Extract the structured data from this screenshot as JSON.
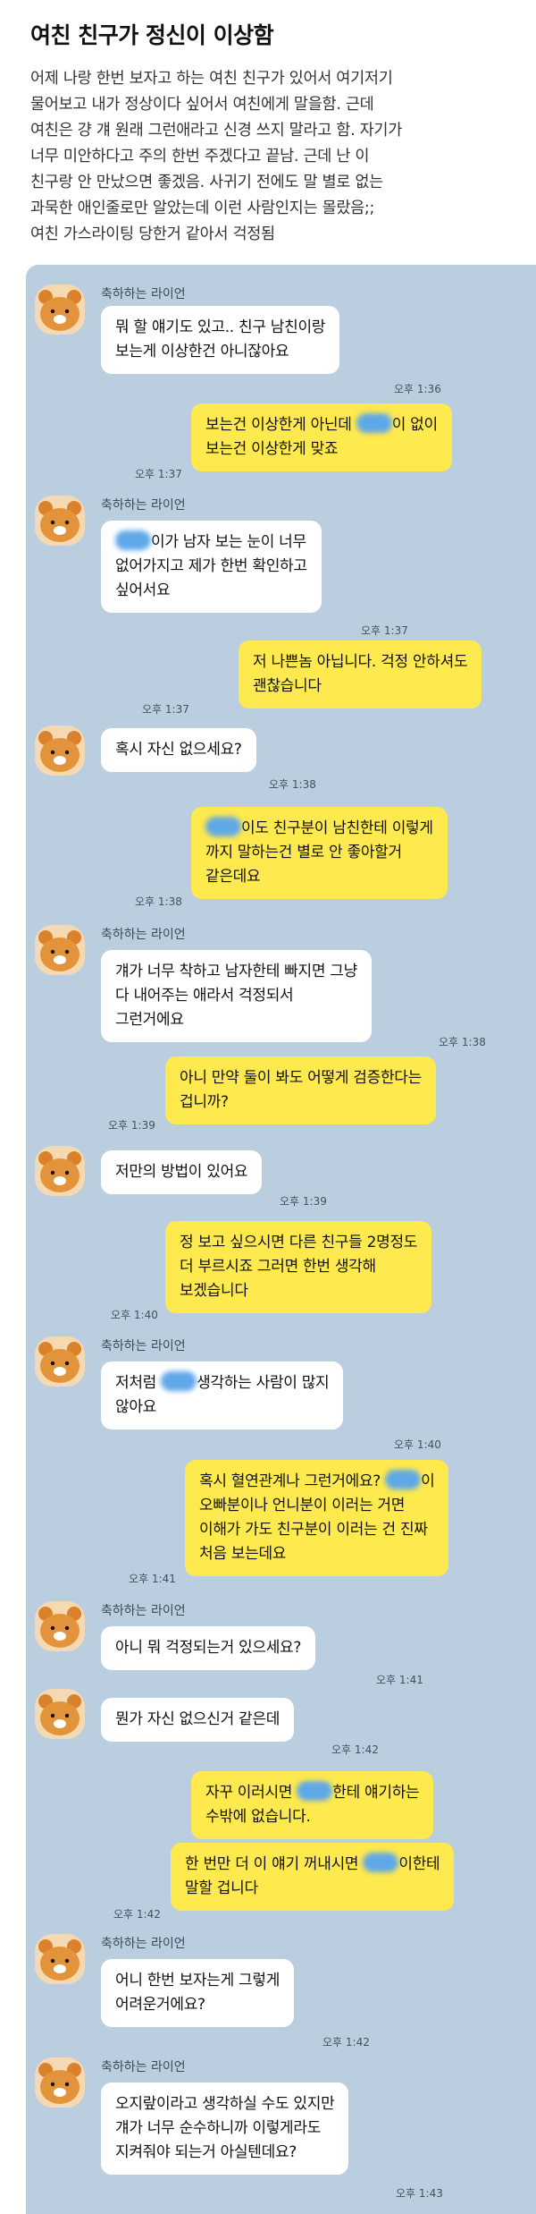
{
  "post": {
    "title": "여친 친구가 정신이 이상함",
    "body": "어제 나랑 한번 보자고 하는 여친 친구가 있어서 여기저기\n물어보고 내가 정상이다 싶어서 여친에게 말을함. 근데\n여친은 걍 걔 원래 그런애라고 신경 쓰지 말라고 함. 자기가\n너무 미안하다고 주의 한번 주겠다고 끝남. 근데 난 이\n친구랑 안 만났으면 좋겠음. 사귀기 전에도 말 별로 없는\n과묵한 애인줄로만 알았는데 이런 사람인지는 몰랐음;;\n여친 가스라이팅 당한거 같아서 걱정됨"
  },
  "sender_name": "축하하는 라이언",
  "messages": [
    {
      "text": "뭐 할 얘기도 있고.. 친구 남친이랑\n보는게 이상한건 아니잖아요",
      "time": "오후 1:36"
    },
    {
      "text_a": "보는건 이상한게 아닌데 ",
      "text_b": "이 없이\n보는건 이상한게 맞죠",
      "time": "오후 1:37"
    },
    {
      "text_a": "",
      "text_b": "이가 남자 보는 눈이 너무\n없어가지고 제가 한번 확인하고\n싶어서요",
      "time": "오후 1:37"
    },
    {
      "text": "저 나쁜놈 아닙니다. 걱정 안하셔도\n괜찮습니다",
      "time": "오후 1:37"
    },
    {
      "text": "혹시 자신 없으세요?",
      "time": "오후 1:38"
    },
    {
      "text_a": "",
      "text_b": "이도 친구분이 남친한테 이렇게\n까지 말하는건 별로 안 좋아할거\n같은데요",
      "time": "오후 1:38"
    },
    {
      "text": "걔가 너무 착하고 남자한테 빠지면 그냥\n다 내어주는 애라서 걱정되서\n그런거에요",
      "time": "오후 1:38"
    },
    {
      "text": "아니 만약 둘이 봐도 어떻게 검증한다는\n겁니까?",
      "time": "오후 1:39"
    },
    {
      "text": "저만의 방법이 있어요",
      "time": "오후 1:39"
    },
    {
      "text": "정 보고 싶으시면 다른 친구들 2명정도\n더 부르시죠 그러면 한번 생각해\n보겠습니다",
      "time": "오후 1:40"
    },
    {
      "text_a": "저처럼 ",
      "text_b": "생각하는 사람이 많지\n않아요",
      "time": "오후 1:40"
    },
    {
      "text_a": "혹시 혈연관계나 그런거에요? ",
      "text_b": "이\n오빠분이나 언니분이 이러는 거면\n이해가 가도 친구분이 이러는 건 진짜\n처음 보는데요",
      "time": "오후 1:41"
    },
    {
      "text": "아니 뭐 걱정되는거 있으세요?",
      "time": "오후 1:41"
    },
    {
      "text": "뭔가 자신 없으신거 같은데",
      "time": "오후 1:42"
    },
    {
      "text_a": "자꾸 이러시면 ",
      "text_b": "한테 얘기하는\n수밖에 없습니다.",
      "time": ""
    },
    {
      "text_a": "한 번만 더 이 얘기 꺼내시면 ",
      "text_b": "이한테\n말할 겁니다",
      "time": "오후 1:42"
    },
    {
      "text": "어니 한번 보자는게 그렇게\n어려운거에요?",
      "time": "오후 1:42"
    },
    {
      "text": "오지랖이라고 생각하실 수도 있지만\n걔가 너무 순수하니까 이렇게라도\n지켜줘야 되는거 아실텐데요?",
      "time": "오후 1:43"
    }
  ],
  "colors": {
    "chat_bg": "#bacee0",
    "mine": "#fee94f",
    "theirs": "#ffffff"
  }
}
